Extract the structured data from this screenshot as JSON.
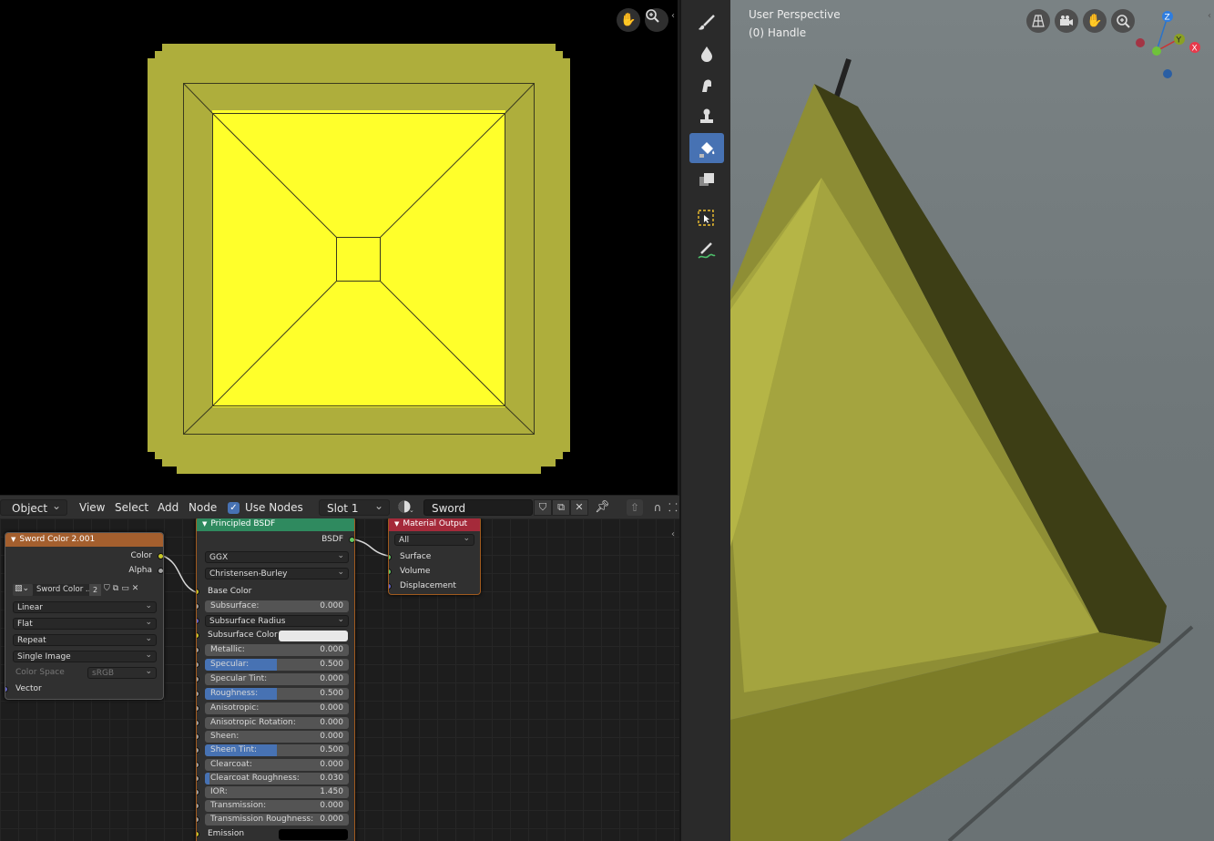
{
  "image_editor": {
    "hand_icon": "hand-icon",
    "zoom_icon": "zoom-icon"
  },
  "node_header": {
    "mode": "Object",
    "menu": [
      "View",
      "Select",
      "Add",
      "Node"
    ],
    "use_nodes_label": "Use Nodes",
    "use_nodes_checked": true,
    "slot": "Slot 1",
    "material_name": "Sword"
  },
  "nodes": {
    "image_texture": {
      "title": "Sword Color 2.001",
      "outputs": [
        "Color",
        "Alpha"
      ],
      "image_name": "Sword Color ...",
      "users": "2",
      "interpolation": "Linear",
      "projection": "Flat",
      "extension": "Repeat",
      "source": "Single Image",
      "color_space_label": "Color Space",
      "color_space_value": "sRGB",
      "input": "Vector"
    },
    "principled": {
      "title": "Principled BSDF",
      "output": "BSDF",
      "distribution": "GGX",
      "subsurface_method": "Christensen-Burley",
      "base_color_label": "Base Color",
      "fields": [
        {
          "label": "Subsurface:",
          "value": "0.000",
          "fill": 0
        },
        {
          "label": "Subsurface Radius",
          "dropdown": true
        },
        {
          "label": "Subsurface Color",
          "swatch": "#e8e8e8"
        },
        {
          "label": "Metallic:",
          "value": "0.000",
          "fill": 0
        },
        {
          "label": "Specular:",
          "value": "0.500",
          "fill": 0.5
        },
        {
          "label": "Specular Tint:",
          "value": "0.000",
          "fill": 0
        },
        {
          "label": "Roughness:",
          "value": "0.500",
          "fill": 0.5
        },
        {
          "label": "Anisotropic:",
          "value": "0.000",
          "fill": 0
        },
        {
          "label": "Anisotropic Rotation:",
          "value": "0.000",
          "fill": 0
        },
        {
          "label": "Sheen:",
          "value": "0.000",
          "fill": 0
        },
        {
          "label": "Sheen Tint:",
          "value": "0.500",
          "fill": 0.5
        },
        {
          "label": "Clearcoat:",
          "value": "0.000",
          "fill": 0
        },
        {
          "label": "Clearcoat Roughness:",
          "value": "0.030",
          "fill": 0.03
        },
        {
          "label": "IOR:",
          "value": "1.450",
          "fill": 0
        },
        {
          "label": "Transmission:",
          "value": "0.000",
          "fill": 0
        },
        {
          "label": "Transmission Roughness:",
          "value": "0.000",
          "fill": 0
        },
        {
          "label": "Emission",
          "swatch": "#000000"
        }
      ]
    },
    "material_output": {
      "title": "Material Output",
      "target": "All",
      "inputs": [
        "Surface",
        "Volume",
        "Displacement"
      ]
    }
  },
  "viewport": {
    "perspective": "User Perspective",
    "object": "(0) Handle",
    "gizmo": {
      "z": "Z",
      "y": "Y",
      "x": "X"
    }
  },
  "colors": {
    "accent": "#4772b3",
    "texture_header": "#a45f2e",
    "shader_header": "#2f8a5f",
    "output_header": "#a52a3a",
    "texture_outer": "#aeae3c",
    "texture_inner": "#ffff2b"
  }
}
